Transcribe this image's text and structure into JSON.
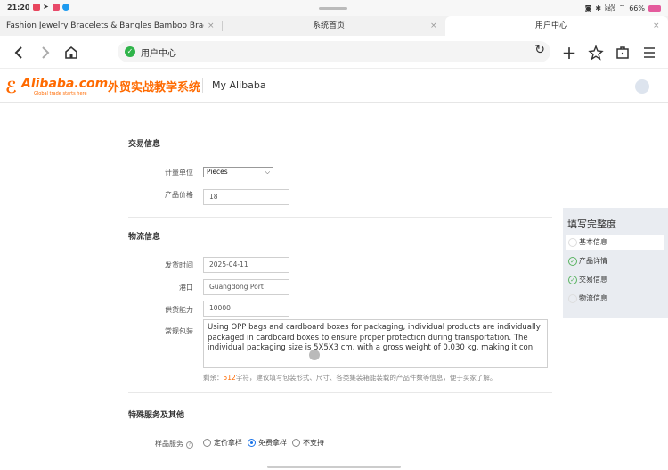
{
  "status_bar": {
    "time": "21:20",
    "net_speed": "0.00\nKB/S",
    "battery": "66%",
    "colors": {
      "battery": "#e45b9d"
    }
  },
  "tabs": [
    {
      "label": "Fashion Jewelry Bracelets & Bangles Bamboo Bracelets ···",
      "close": "×"
    },
    {
      "label": "系统首页",
      "close": "×"
    },
    {
      "label": "用户中心",
      "close": "×"
    }
  ],
  "active_tab_index": 2,
  "toolbar": {
    "back_icon": "chevron-left",
    "forward_icon": "chevron-right",
    "home_icon": "home",
    "url": "用户中心",
    "reload_icon": "refresh",
    "new_tab_icon": "plus",
    "bookmark_icon": "star",
    "share_icon": "briefcase",
    "menu_icon": "hamburger"
  },
  "site_header": {
    "logo_brand": "Alibaba.com",
    "logo_tagline": "Global trade starts here",
    "logo_cn": "外贸实战教学系统",
    "my_alibaba": "My Alibaba",
    "colors": {
      "brand": "#ff6a00"
    }
  },
  "sections": {
    "trade": {
      "title": "交易信息",
      "unit_label": "计量单位",
      "unit_value": "Pieces",
      "price_label": "产品价格",
      "price_value": "18"
    },
    "logistics": {
      "title": "物流信息",
      "ship_time_label": "发货时间",
      "ship_time_value": "2025-04-11",
      "port_label": "港口",
      "port_value": "Guangdong Port",
      "supply_label": "供货能力",
      "supply_value": "10000",
      "packaging_label": "常规包装",
      "packaging_value": "Using OPP bags and cardboard boxes for packaging, individual products are individually packaged in cardboard boxes to ensure proper protection during transportation. The individual packaging size is 5X5X3 cm, with a gross weight of 0.030 kg, making it con",
      "hint_prefix": "剩余：",
      "hint_count": "512",
      "hint_suffix": "字符，建议填写包装形式、尺寸、各类集装箱能装载的产品件数等信息，便于买家了解。"
    },
    "special": {
      "title": "特殊服务及其他",
      "sample_label": "样品服务",
      "options": [
        "定价拿样",
        "免费拿样",
        "不支持"
      ],
      "selected": "免费拿样"
    }
  },
  "completeness_panel": {
    "title": "填写完整度",
    "items": [
      {
        "label": "基本信息",
        "done": false
      },
      {
        "label": "产品详情",
        "done": true
      },
      {
        "label": "交易信息",
        "done": true
      },
      {
        "label": "物流信息",
        "done": false
      }
    ],
    "colors": {
      "check": "#5bb462"
    }
  }
}
